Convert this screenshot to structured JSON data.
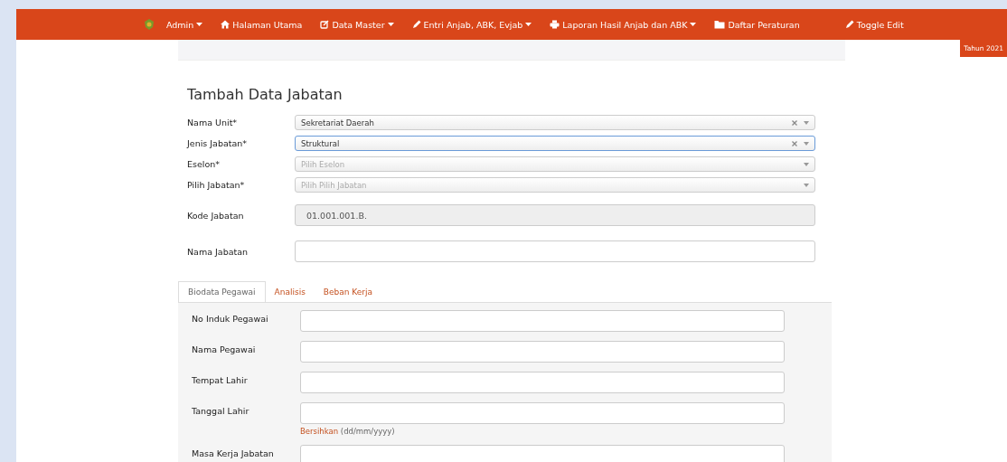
{
  "navbar": {
    "items": [
      {
        "label": "Admin",
        "dropdown": true
      },
      {
        "label": "Halaman Utama",
        "dropdown": false
      },
      {
        "label": "Data Master",
        "dropdown": true
      },
      {
        "label": "Entri Anjab, ABK, Evjab",
        "dropdown": true
      },
      {
        "label": "Laporan Hasil Anjab dan ABK",
        "dropdown": true
      },
      {
        "label": "Daftar Peraturan",
        "dropdown": false
      },
      {
        "label": "Toggle Edit",
        "dropdown": false
      }
    ],
    "year_badge": "Tahun 2021"
  },
  "form": {
    "title": "Tambah Data Jabatan",
    "fields": [
      {
        "label": "Nama Unit*",
        "kind": "select",
        "value": "Sekretariat Daerah",
        "clearable": true,
        "focused": false
      },
      {
        "label": "Jenis Jabatan*",
        "kind": "select",
        "value": "Struktural",
        "clearable": true,
        "focused": true
      },
      {
        "label": "Eselon*",
        "kind": "select",
        "placeholder": "Pilih Eselon",
        "clearable": false,
        "focused": false
      },
      {
        "label": "Pilih Jabatan*",
        "kind": "select",
        "placeholder": "Pilih Pilih Jabatan",
        "clearable": false,
        "focused": false
      },
      {
        "label": "Kode Jabatan",
        "kind": "readonly",
        "value": "01.001.001.B."
      },
      {
        "label": "Nama Jabatan",
        "kind": "text"
      }
    ]
  },
  "tabs": [
    {
      "label": "Biodata Pegawai",
      "selected": true
    },
    {
      "label": "Analisis",
      "selected": false
    },
    {
      "label": "Beban Kerja",
      "selected": false
    }
  ],
  "biodata": {
    "fields": [
      {
        "label": "No Induk Pegawai"
      },
      {
        "label": "Nama Pegawai"
      },
      {
        "label": "Tempat Lahir"
      },
      {
        "label": "Tanggal Lahir",
        "help_link": "Bersihkan",
        "help_text": "(dd/mm/yyyy)"
      },
      {
        "label": "Masa Kerja Jabatan"
      }
    ]
  }
}
